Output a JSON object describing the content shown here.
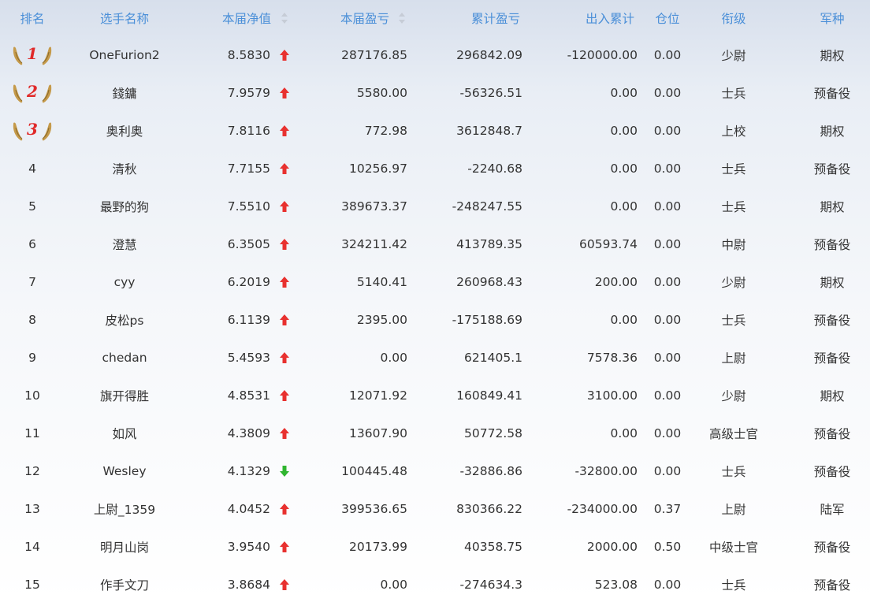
{
  "header": {
    "rank": "排名",
    "name": "选手名称",
    "nav": "本届净值",
    "profit": "本届盈亏",
    "total": "累计盈亏",
    "inout": "出入累计",
    "position": "仓位",
    "title": "衔级",
    "arm": "军种"
  },
  "colors": {
    "header_text": "#4a8fd8",
    "up_arrow": "#e8312f",
    "down_arrow": "#2fb52f",
    "medal_number": "#e02a2a",
    "medal_wing": "#c59a4a"
  },
  "rows": [
    {
      "rank": "1",
      "medal": true,
      "name": "OneFurion2",
      "nav": "8.5830",
      "trend": "up",
      "profit": "287176.85",
      "total": "296842.09",
      "inout": "-120000.00",
      "position": "0.00",
      "title": "少尉",
      "arm": "期权"
    },
    {
      "rank": "2",
      "medal": true,
      "name": "錢鏞",
      "nav": "7.9579",
      "trend": "up",
      "profit": "5580.00",
      "total": "-56326.51",
      "inout": "0.00",
      "position": "0.00",
      "title": "士兵",
      "arm": "预备役"
    },
    {
      "rank": "3",
      "medal": true,
      "name": "奥利奥",
      "nav": "7.8116",
      "trend": "up",
      "profit": "772.98",
      "total": "3612848.7",
      "inout": "0.00",
      "position": "0.00",
      "title": "上校",
      "arm": "期权"
    },
    {
      "rank": "4",
      "medal": false,
      "name": "清秋",
      "nav": "7.7155",
      "trend": "up",
      "profit": "10256.97",
      "total": "-2240.68",
      "inout": "0.00",
      "position": "0.00",
      "title": "士兵",
      "arm": "预备役"
    },
    {
      "rank": "5",
      "medal": false,
      "name": "最野的狗",
      "nav": "7.5510",
      "trend": "up",
      "profit": "389673.37",
      "total": "-248247.55",
      "inout": "0.00",
      "position": "0.00",
      "title": "士兵",
      "arm": "期权"
    },
    {
      "rank": "6",
      "medal": false,
      "name": "澄慧",
      "nav": "6.3505",
      "trend": "up",
      "profit": "324211.42",
      "total": "413789.35",
      "inout": "60593.74",
      "position": "0.00",
      "title": "中尉",
      "arm": "预备役"
    },
    {
      "rank": "7",
      "medal": false,
      "name": "cyy",
      "nav": "6.2019",
      "trend": "up",
      "profit": "5140.41",
      "total": "260968.43",
      "inout": "200.00",
      "position": "0.00",
      "title": "少尉",
      "arm": "期权"
    },
    {
      "rank": "8",
      "medal": false,
      "name": "皮松ps",
      "nav": "6.1139",
      "trend": "up",
      "profit": "2395.00",
      "total": "-175188.69",
      "inout": "0.00",
      "position": "0.00",
      "title": "士兵",
      "arm": "预备役"
    },
    {
      "rank": "9",
      "medal": false,
      "name": "chedan",
      "nav": "5.4593",
      "trend": "up",
      "profit": "0.00",
      "total": "621405.1",
      "inout": "7578.36",
      "position": "0.00",
      "title": "上尉",
      "arm": "预备役"
    },
    {
      "rank": "10",
      "medal": false,
      "name": "旗开得胜",
      "nav": "4.8531",
      "trend": "up",
      "profit": "12071.92",
      "total": "160849.41",
      "inout": "3100.00",
      "position": "0.00",
      "title": "少尉",
      "arm": "期权"
    },
    {
      "rank": "11",
      "medal": false,
      "name": "如风",
      "nav": "4.3809",
      "trend": "up",
      "profit": "13607.90",
      "total": "50772.58",
      "inout": "0.00",
      "position": "0.00",
      "title": "高级士官",
      "arm": "预备役"
    },
    {
      "rank": "12",
      "medal": false,
      "name": "Wesley",
      "nav": "4.1329",
      "trend": "down",
      "profit": "100445.48",
      "total": "-32886.86",
      "inout": "-32800.00",
      "position": "0.00",
      "title": "士兵",
      "arm": "预备役"
    },
    {
      "rank": "13",
      "medal": false,
      "name": "上尉_1359",
      "nav": "4.0452",
      "trend": "up",
      "profit": "399536.65",
      "total": "830366.22",
      "inout": "-234000.00",
      "position": "0.37",
      "title": "上尉",
      "arm": "陆军"
    },
    {
      "rank": "14",
      "medal": false,
      "name": "明月山岗",
      "nav": "3.9540",
      "trend": "up",
      "profit": "20173.99",
      "total": "40358.75",
      "inout": "2000.00",
      "position": "0.50",
      "title": "中级士官",
      "arm": "预备役"
    },
    {
      "rank": "15",
      "medal": false,
      "name": "作手文刀",
      "nav": "3.8684",
      "trend": "up",
      "profit": "0.00",
      "total": "-274634.3",
      "inout": "523.08",
      "position": "0.00",
      "title": "士兵",
      "arm": "预备役"
    }
  ]
}
